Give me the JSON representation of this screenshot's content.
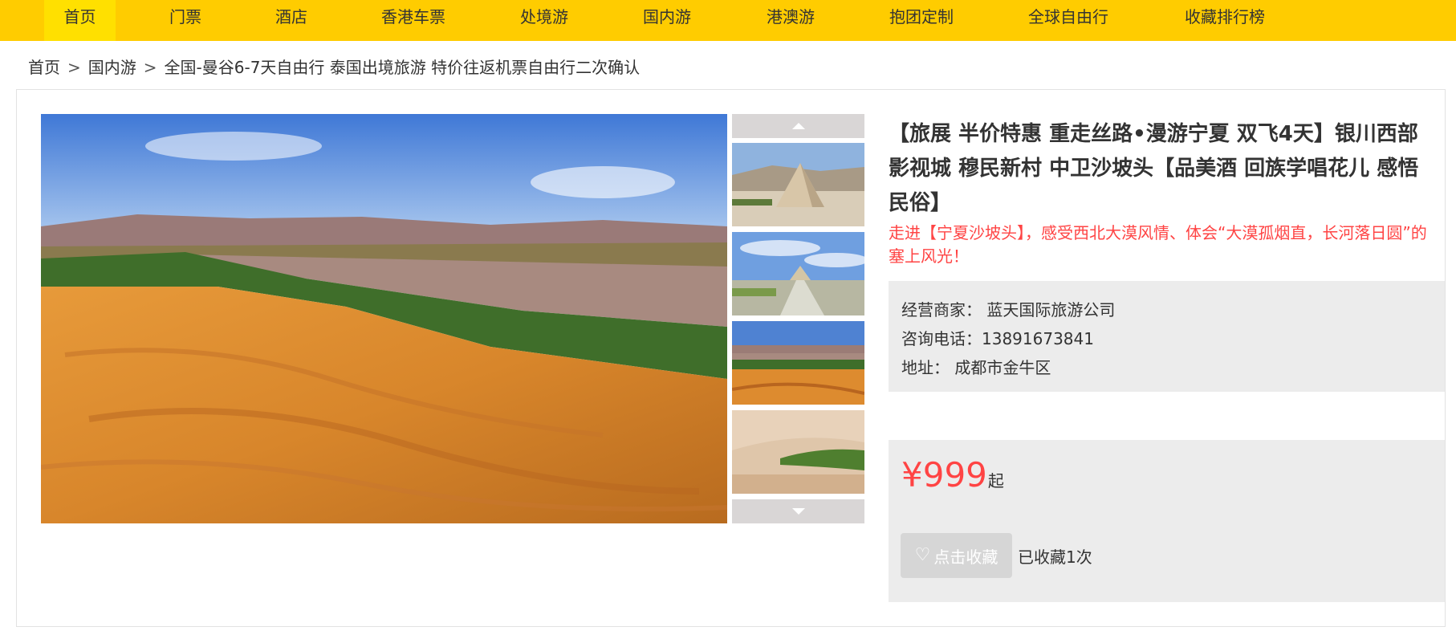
{
  "nav": {
    "items": [
      {
        "label": "首页",
        "active": true
      },
      {
        "label": "门票"
      },
      {
        "label": "酒店"
      },
      {
        "label": "香港车票"
      },
      {
        "label": "处境游"
      },
      {
        "label": "国内游"
      },
      {
        "label": "港澳游"
      },
      {
        "label": "抱团定制"
      },
      {
        "label": "全球自由行"
      },
      {
        "label": "收藏排行榜"
      }
    ]
  },
  "breadcrumb": {
    "home": "首页",
    "separator": ">",
    "category": "国内游",
    "current": "全国-曼谷6-7天自由行 泰国出境旅游 特价往返机票自由行二次确认"
  },
  "product": {
    "title": "【旅展 半价特惠 重走丝路•漫游宁夏 双飞4天】银川西部影视城 穆民新村 中卫沙坡头【品美酒 回族学唱花儿 感悟民俗】",
    "slogan": "走进【宁夏沙坡头】，感受西北大漠风情、体会“大漠孤烟直，长河落日圆”的塞上风光！",
    "merchant_label": "经营商家：",
    "merchant_value": "蓝天国际旅游公司",
    "phone_label": "咨询电话：",
    "phone_value": "13891673841",
    "address_label": "地址：",
    "address_value": "成都市金牛区",
    "price_symbol": "¥",
    "price_value": "999",
    "price_unit": "起",
    "favorite_label": "点击收藏",
    "favorite_count_text": "已收藏1次"
  },
  "gallery": {
    "main_image": "desert-river-landscape",
    "thumbnails": [
      "pyramid-tomb-desert",
      "tomb-road-sky",
      "desert-river-landscape",
      "river-sand-dunes"
    ],
    "arrow_up_icon": "chevron-up-icon",
    "arrow_down_icon": "chevron-down-icon"
  },
  "colors": {
    "nav_bg": "#ffcc00",
    "nav_active_bg": "#ffe000",
    "accent_red": "#ff4444",
    "box_bg": "#ececec"
  }
}
